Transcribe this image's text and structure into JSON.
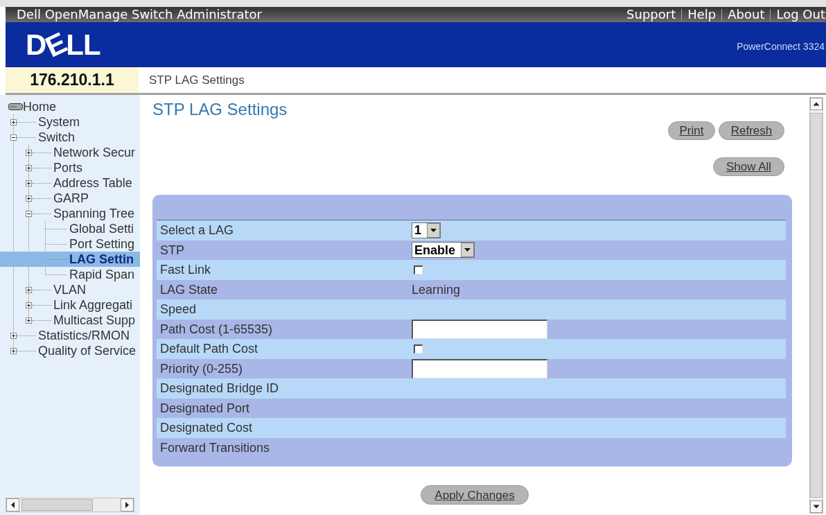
{
  "window": {
    "title": "Dell OpenManage Switch Administrator"
  },
  "header_links": [
    {
      "label": "Support"
    },
    {
      "label": "Help"
    },
    {
      "label": "About"
    },
    {
      "label": "Log Out"
    }
  ],
  "banner": {
    "logo": "DELL",
    "product": "PowerConnect 3324"
  },
  "address_bar": {
    "device_ip": "176.210.1.1",
    "breadcrumb": "STP LAG Settings"
  },
  "sidebar": {
    "tree": [
      {
        "label": "Home",
        "selected": false,
        "children": [
          {
            "label": "System",
            "expanded": false,
            "selected": false
          },
          {
            "label": "Switch",
            "expanded": true,
            "selected": false,
            "children": [
              {
                "label": "Network Secur",
                "expanded": false,
                "selected": false
              },
              {
                "label": "Ports",
                "expanded": false,
                "selected": false
              },
              {
                "label": "Address Table",
                "expanded": false,
                "selected": false
              },
              {
                "label": "GARP",
                "expanded": false,
                "selected": false
              },
              {
                "label": "Spanning Tree",
                "expanded": true,
                "selected": false,
                "children": [
                  {
                    "label": "Global Setti",
                    "selected": false
                  },
                  {
                    "label": "Port Setting",
                    "selected": false
                  },
                  {
                    "label": "LAG Settin",
                    "selected": true
                  },
                  {
                    "label": "Rapid Span",
                    "selected": false
                  }
                ]
              },
              {
                "label": "VLAN",
                "expanded": false,
                "selected": false
              },
              {
                "label": "Link Aggregati",
                "expanded": false,
                "selected": false
              },
              {
                "label": "Multicast Supp",
                "expanded": false,
                "selected": false
              }
            ]
          },
          {
            "label": "Statistics/RMON",
            "expanded": false,
            "selected": false
          },
          {
            "label": "Quality of Service",
            "expanded": false,
            "selected": false
          }
        ]
      }
    ]
  },
  "page": {
    "title": "STP LAG Settings",
    "print_button": "Print",
    "refresh_button": "Refresh",
    "show_all_button": "Show All",
    "form": {
      "rows": [
        {
          "label": "Select a LAG",
          "kind": "select",
          "value": "1"
        },
        {
          "label": "STP",
          "kind": "select",
          "value": "Enable"
        },
        {
          "label": "Fast Link",
          "kind": "checkbox",
          "checked": false
        },
        {
          "label": "LAG State",
          "kind": "text",
          "value": "Learning"
        },
        {
          "label": "Speed",
          "kind": "text"
        },
        {
          "label": "Path Cost (1-65535)",
          "kind": "input"
        },
        {
          "label": "Default Path Cost",
          "kind": "checkbox",
          "checked": false
        },
        {
          "label": "Priority (0-255)",
          "kind": "input"
        },
        {
          "label": "Designated Bridge ID",
          "kind": "text"
        },
        {
          "label": "Designated Port",
          "kind": "text"
        },
        {
          "label": "Designated Cost",
          "kind": "text"
        },
        {
          "label": "Forward Transitions",
          "kind": "text"
        }
      ]
    },
    "apply_button": "Apply Changes"
  }
}
